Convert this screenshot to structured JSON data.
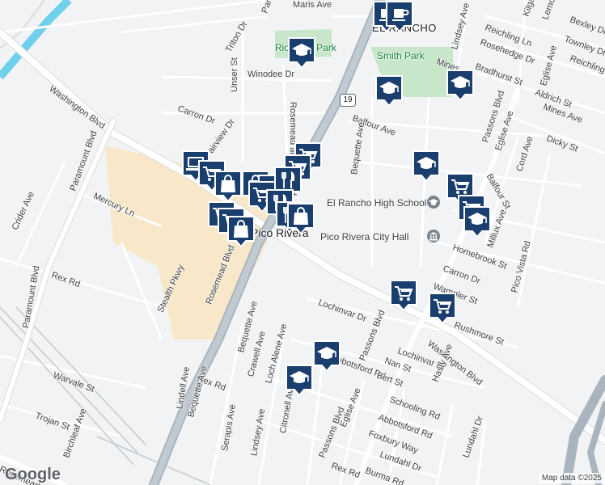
{
  "map": {
    "attribution": "Map data ©2025",
    "logo_text": "Google",
    "area_labels": {
      "el_rancho": "EL RANCHO",
      "pico_rivera": "Pico Rivera"
    },
    "park_labels": {
      "smith_park": "Smith Park",
      "rio_park": "Rio Vista Park"
    },
    "poi_labels": {
      "high_school": "El Rancho High School",
      "city_hall": "Pico Rivera City Hall"
    },
    "highway_shield": "19",
    "streets": {
      "maris_ave": "Maris Ave",
      "paramount_top": "Paramount",
      "triton_dr": "Triton Dr",
      "lindsey_ave_top": "Lindsey Ave",
      "reichling_ln": "Reichling Ln",
      "kilgarry": "Kilga",
      "lemoran": "Lemora",
      "bexley_dr": "Bexley Dr",
      "townley_dr": "Townley Dr",
      "reichling_top": "Reichling",
      "rosehedge_dr": "Rosehedge Dr",
      "bradhurst_st": "Bradhurst St",
      "mines": "Mines",
      "eglise_ave_top": "Eglise Ave",
      "aldrich_st": "Aldrich St",
      "washington_blvd_left": "Washington Blvd",
      "unser_st": "Unser St",
      "winodee_dr": "Winodee Dr",
      "rosemead_and_pico": "Rosemead and Pico Rd",
      "balfour_ave": "Balfour Ave",
      "mines_ave": "Mines Ave",
      "passons_blvd_top": "Passons Blvd",
      "carron_dr_left": "Carron Dr",
      "fairview_dr": "Fairview Dr",
      "bequette_ave_top": "Bequette Ave",
      "eglise_ave_mid": "Eglise Ave",
      "cord_ave": "Cord Ave",
      "dicky_st": "Dicky St",
      "paramount_blvd_mid": "Paramount Blvd",
      "balfour_st": "Balfour St",
      "crider_ave": "Crider Ave",
      "mercury_ln": "Mercury Ln",
      "millux_ave": "Millux Ave",
      "homebrook_st": "Homebrook St",
      "pico_vista_rd": "Pico Vista Rd",
      "carron_dr_right": "Carron Dr",
      "rex_rd_left": "Rex Rd",
      "wampler_st": "Wampler St",
      "rosemead_blvd": "Rosemead Blvd",
      "lochinvar_dr": "Lochinvar Dr",
      "stealth_pkwy": "Stealth Pkwy",
      "rushmore_st": "Rushmore St",
      "paramount_blvd_bottom": "Paramount Blvd",
      "washington_blvd_right": "Washington Blvd",
      "bequette_ave_mid": "Bequette Ave",
      "lochinvar_dr_2": "Lochinvar Dr",
      "passons_blvd_mid": "Passons Blvd",
      "crawell_ave": "Crawell Ave",
      "loch_alene_ave": "Loch Alene Ave",
      "abbotsford_mid": "Abbotsford Rd",
      "nan_st": "Nan St",
      "bert_st": "Bert St",
      "hasty_ave": "Hasty Ave",
      "warvale_st": "Warvale St",
      "rex_rd_mid": "Rex Rd",
      "lindell_ave": "Lindell Ave",
      "bequette_ave_bottom": "Bequette Ave",
      "citronell_ave": "Citronell Ave",
      "trojan_st": "Trojan St",
      "schooling_rd": "Schooling Rd",
      "abbotsford_rd": "Abbotsford Rd",
      "eglise_ave_bottom": "Eglise Ave",
      "serapis_ave": "Serapis Ave",
      "lindsey_ave_bottom": "Lindsey Ave",
      "foxbury_way": "Foxbury Way",
      "passons_blvd_bottom": "Passons Blvd",
      "birchleaf_ave": "Birchleaf Ave",
      "lundahl_dr": "Lundahl Dr",
      "lundahl_dr_2": "Lundahl Dr",
      "rex_rd_bottom": "Rex Rd",
      "burma_rd": "Burma Rd",
      "rosemead_bottom_left": "Rosemead"
    },
    "colors": {
      "pin_fill": "#1a3e6e",
      "pin_border": "#ffffff",
      "park_green": "#c8e6c9",
      "commercial": "#f8e8c9",
      "road_major": "#ffffff",
      "freeway": "#aab4be",
      "water": "#6fd0ec"
    },
    "pin_icons": [
      "coffee-cup-icon",
      "graduation-cap-icon",
      "shopping-cart-icon",
      "shopping-bag-icon",
      "restaurant-icon",
      "computer-icon"
    ]
  }
}
